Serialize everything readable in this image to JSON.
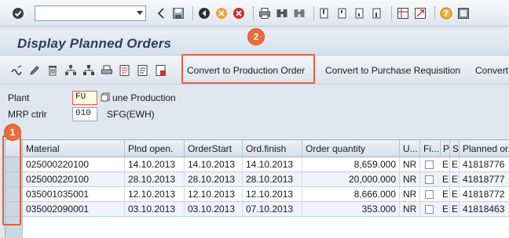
{
  "title": "Display Planned Orders",
  "toolbar": {
    "icons": [
      "check-icon",
      "back-icon",
      "save-icon",
      "exit-icon",
      "cancel-icon",
      "print-icon",
      "find-icon",
      "find-next-icon",
      "first-page-icon",
      "prev-page-icon",
      "next-page-icon",
      "last-page-icon",
      "layout-icon",
      "create-session-icon",
      "help-icon",
      "customize-icon"
    ]
  },
  "app_toolbar": {
    "buttons": [
      "Convert to Production Order",
      "Convert to Purchase Requisition",
      "Convert"
    ]
  },
  "annotations": {
    "badge1": "1",
    "badge2": "2"
  },
  "form": {
    "plant_label": "Plant",
    "plant_value": "FU",
    "plant_desc": "une Production",
    "mrp_label": "MRP ctrlr",
    "mrp_value": "010",
    "mrp_desc": "SFG(EWH)"
  },
  "table": {
    "headers": [
      "Material",
      "Plnd open.",
      "OrderStart",
      "Ord.finish",
      "Order quantity",
      "U...",
      "Fi...",
      "P",
      "S",
      "Planned or..."
    ],
    "rows": [
      {
        "material": "025000220100",
        "plnd_open": "14.10.2013",
        "order_start": "14.10.2013",
        "ord_finish": "14.10.2013",
        "qty": "8,659.000",
        "unit": "NR",
        "p": "E",
        "s": "E",
        "planned": "41818776"
      },
      {
        "material": "025000220100",
        "plnd_open": "28.10.2013",
        "order_start": "28.10.2013",
        "ord_finish": "28.10.2013",
        "qty": "20,000.000",
        "unit": "NR",
        "p": "E",
        "s": "E",
        "planned": "41818777"
      },
      {
        "material": "035001035001",
        "plnd_open": "12.10.2013",
        "order_start": "12.10.2013",
        "ord_finish": "12.10.2013",
        "qty": "8,666.000",
        "unit": "NR",
        "p": "E",
        "s": "E",
        "planned": "41818772"
      },
      {
        "material": "035002090001",
        "plnd_open": "03.10.2013",
        "order_start": "03.10.2013",
        "ord_finish": "07.10.2013",
        "qty": "353.000",
        "unit": "NR",
        "p": "E",
        "s": "E",
        "planned": "41818463"
      }
    ]
  },
  "colors": {
    "accent": "#e0603c",
    "title": "#2a3f5f",
    "background": "#dfe6ef"
  }
}
